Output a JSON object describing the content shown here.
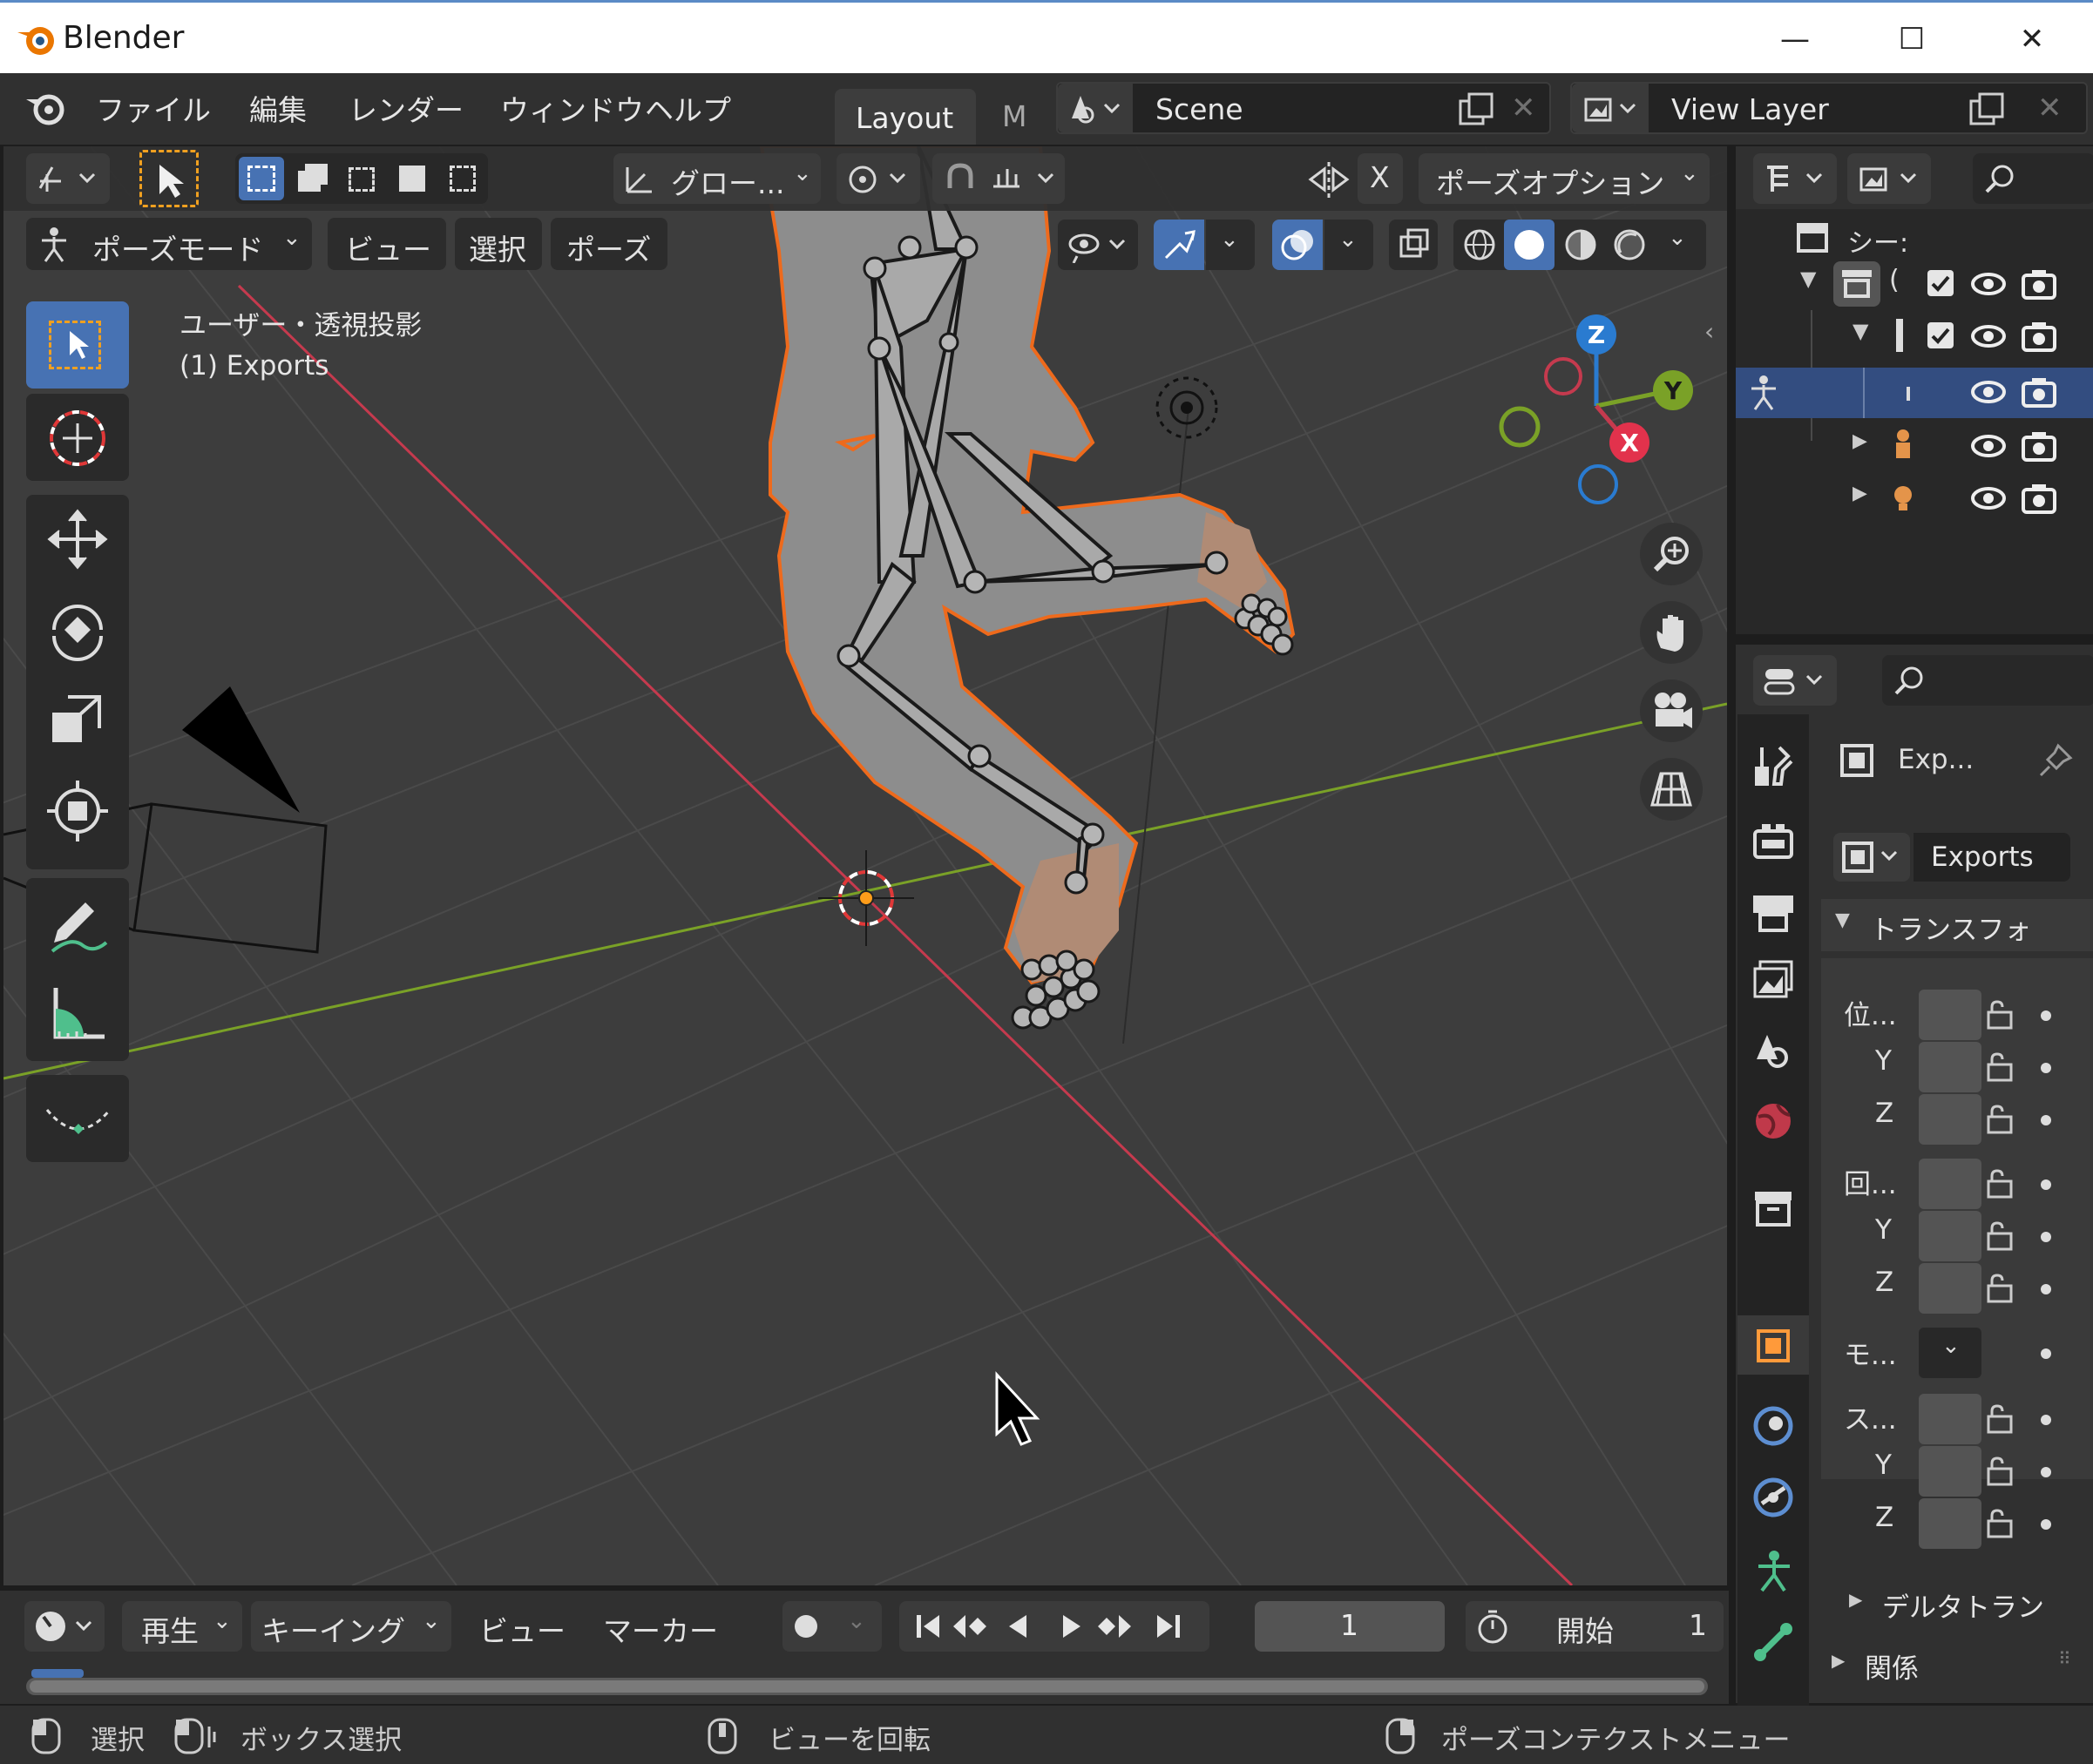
{
  "window": {
    "title": "Blender",
    "minimize": "—",
    "maximize": "☐",
    "close": "✕"
  },
  "topmenu": {
    "items": [
      "ファイル",
      "編集",
      "レンダー",
      "ウィンドウ",
      "ヘルプ"
    ],
    "workspace_tabs": [
      "Layout",
      "M"
    ],
    "scene_label": "Scene",
    "view_layer_label": "View Layer"
  },
  "tool_header": {
    "orientation": "グロー...",
    "axis_x": "X",
    "pose_options": "ポーズオプション"
  },
  "viewport_header": {
    "mode": "ポーズモード",
    "menus": [
      "ビュー",
      "選択",
      "ポーズ"
    ]
  },
  "viewport": {
    "view_name": "ユーザー・透視投影",
    "object_info": "(1) Exports",
    "gizmo_axes": {
      "z": "Z",
      "y": "Y",
      "x": "X"
    },
    "colors": {
      "x_axis": "#c53a4e",
      "y_axis": "#7aa127",
      "z_axis": "#2a7bd0",
      "outline": "#ee6a1c"
    }
  },
  "outliner": {
    "scene_collection": "シー:",
    "rows": [
      {
        "label": "("
      },
      {
        "label": ""
      },
      {
        "label": ""
      },
      {
        "label": ""
      },
      {
        "label": ""
      }
    ]
  },
  "properties": {
    "object_name_short": "Exp...",
    "object_name": "Exports",
    "section_transform": "トランスフォ",
    "location_label": "位...",
    "rotation_label": "回...",
    "mode_label": "モ...",
    "scale_label": "ス...",
    "axis_y": "Y",
    "axis_z": "Z",
    "section_delta": "デルタトラン",
    "section_relations": "関係"
  },
  "timeline": {
    "menus": [
      "再生",
      "キーイング",
      "ビュー",
      "マーカー"
    ],
    "current_frame": "1",
    "start_label": "開始",
    "start_value": "1"
  },
  "statusbar": {
    "select": "選択",
    "box_select": "ボックス選択",
    "rotate_view": "ビューを回転",
    "context_menu": "ポーズコンテクストメニュー"
  }
}
